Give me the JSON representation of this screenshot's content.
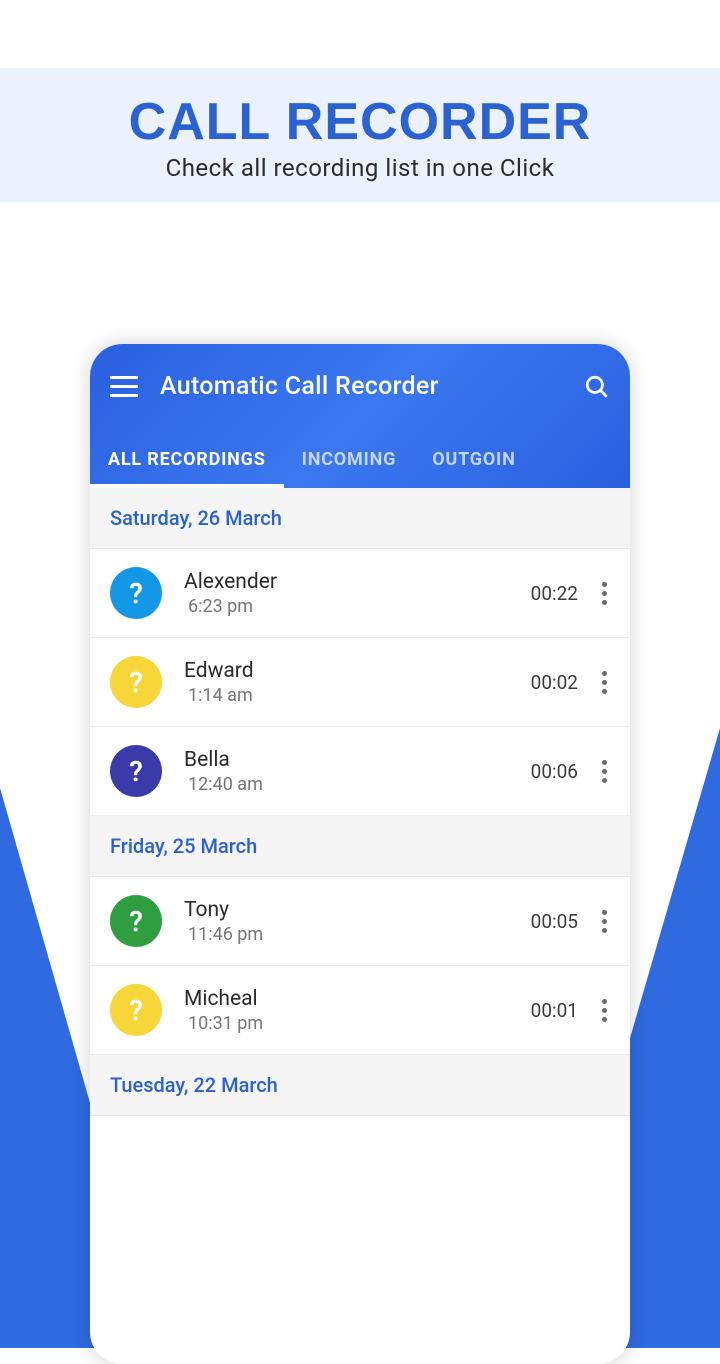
{
  "banner": {
    "title": "CALL RECORDER",
    "subtitle": "Check all recording list in one Click"
  },
  "app": {
    "title": "Automatic Call Recorder",
    "tabs": [
      {
        "label": "ALL RECORDINGS",
        "active": true
      },
      {
        "label": "INCOMING",
        "active": false
      },
      {
        "label": "OUTGOIN",
        "active": false
      }
    ]
  },
  "avatar_placeholder": "?",
  "sections": [
    {
      "header": "Saturday, 26 March",
      "items": [
        {
          "name": "Alexender",
          "time": "6:23 pm",
          "duration": "00:22",
          "avatar_class": "av-blue"
        },
        {
          "name": "Edward",
          "time": "1:14 am",
          "duration": "00:02",
          "avatar_class": "av-yellow"
        },
        {
          "name": "Bella",
          "time": "12:40 am",
          "duration": "00:06",
          "avatar_class": "av-indigo"
        }
      ]
    },
    {
      "header": "Friday, 25 March",
      "items": [
        {
          "name": "Tony",
          "time": "11:46 pm",
          "duration": "00:05",
          "avatar_class": "av-green"
        },
        {
          "name": "Micheal",
          "time": "10:31 pm",
          "duration": "00:01",
          "avatar_class": "av-yellow"
        }
      ]
    },
    {
      "header": "Tuesday, 22 March",
      "items": []
    }
  ]
}
